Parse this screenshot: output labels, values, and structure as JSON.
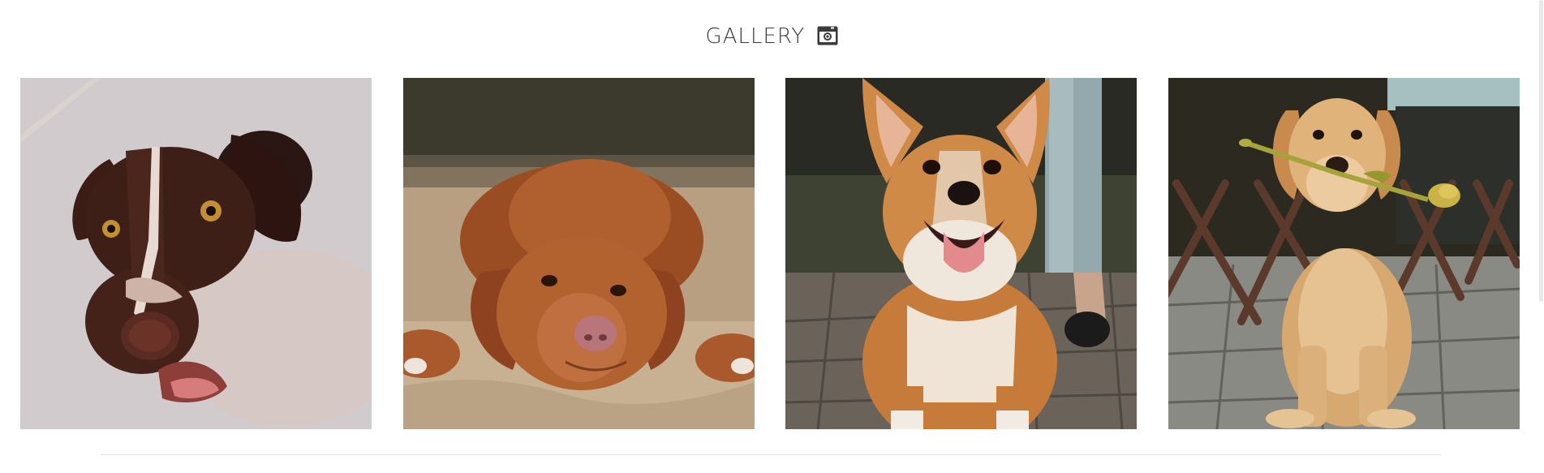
{
  "gallery": {
    "title": "GALLERY",
    "title_icon": "camera-icon",
    "images": [
      {
        "name": "dog-photo-brown-pointer"
      },
      {
        "name": "dog-photo-toller"
      },
      {
        "name": "dog-photo-corgi"
      },
      {
        "name": "dog-photo-golden-retriever"
      }
    ]
  },
  "colors": {
    "title": "#3a3a3a",
    "divider": "#e4e4e4"
  }
}
